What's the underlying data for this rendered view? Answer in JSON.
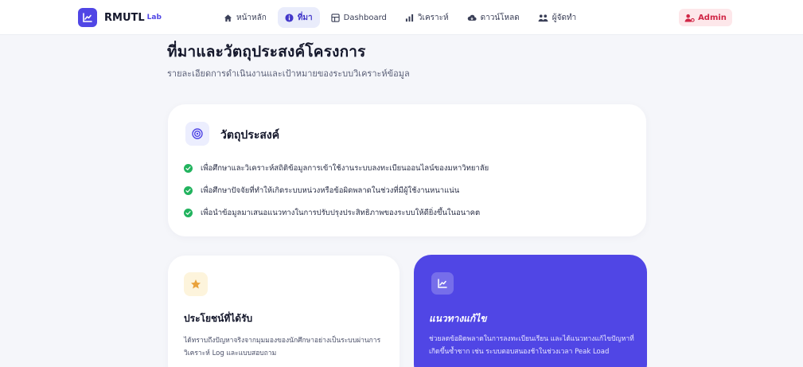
{
  "brand": {
    "name": "RMUTL",
    "sub": "Lab"
  },
  "nav": {
    "items": [
      {
        "label": "หน้าหลัก",
        "icon": "home-icon",
        "active": false
      },
      {
        "label": "ที่มา",
        "icon": "info-icon",
        "active": true
      },
      {
        "label": "Dashboard",
        "icon": "grid-icon",
        "active": false
      },
      {
        "label": "วิเคราะห์",
        "icon": "analysis-icon",
        "active": false
      },
      {
        "label": "ดาวน์โหลด",
        "icon": "cloud-download-icon",
        "active": false
      },
      {
        "label": "ผู้จัดทำ",
        "icon": "team-icon",
        "active": false
      }
    ],
    "admin_label": "Admin"
  },
  "hero": {
    "title": "ที่มาและวัตถุประสงค์โครงการ",
    "subtitle": "รายละเอียดการดำเนินงานและเป้าหมายของระบบวิเคราะห์ข้อมูล"
  },
  "objectives": {
    "title": "วัตถุประสงค์",
    "items": [
      "เพื่อศึกษาและวิเคราะห์สถิติข้อมูลการเข้าใช้งานระบบลงทะเบียนออนไลน์ของมหาวิทยาลัย",
      "เพื่อศึกษาปัจจัยที่ทำให้เกิดระบบหน่วงหรือข้อผิดพลาดในช่วงที่มีผู้ใช้งานหนาแน่น",
      "เพื่อนำข้อมูลมาเสนอแนวทางในการปรับปรุงประสิทธิภาพของระบบให้ดียิ่งขึ้นในอนาคต"
    ]
  },
  "benefits": {
    "title": "ประโยชน์ที่ได้รับ",
    "description": "ได้ทราบถึงปัญหาจริงจากมุมมองของนักศึกษาอย่างเป็นระบบผ่านการวิเคราะห์ Log และแบบสอบถาม"
  },
  "solution": {
    "title": "แนวทางแก้ไข",
    "description": "ช่วยลดข้อผิดพลาดในการลงทะเบียนเรียน และได้แนวทางแก้ไขปัญหาที่เกิดขึ้นซ้ำซาก เช่น ระบบตอบสนองช้าในช่วงเวลา Peak Load"
  },
  "colors": {
    "accent": "#5046e5",
    "success": "#22b35e",
    "admin": "#d02646",
    "star": "#e9a23b"
  }
}
